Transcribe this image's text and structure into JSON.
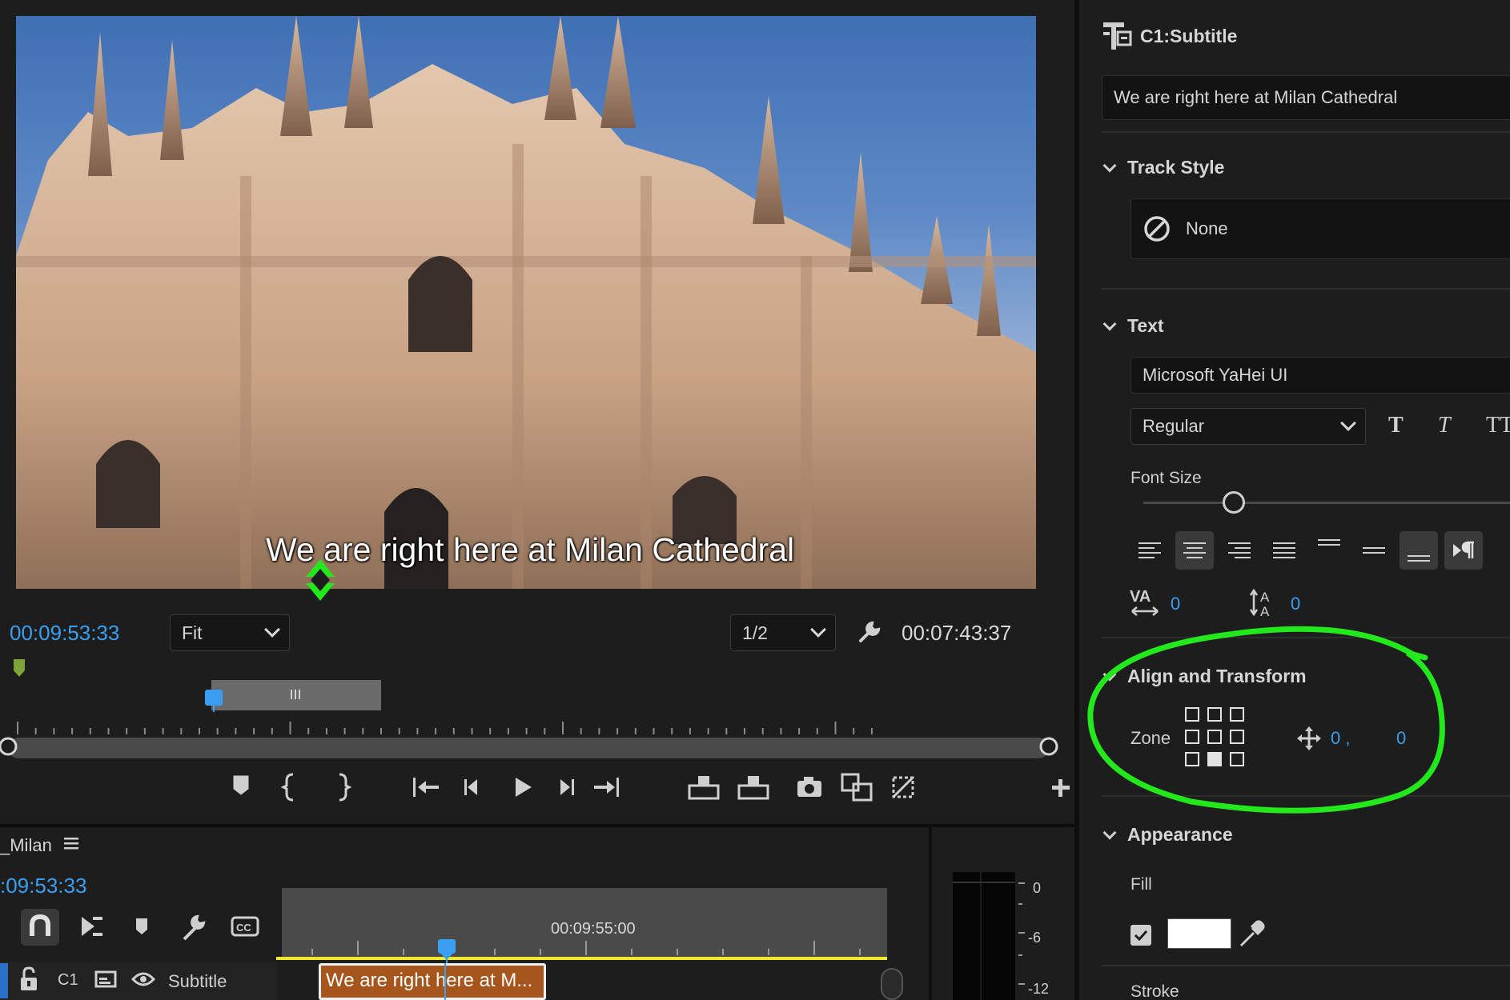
{
  "monitor": {
    "subtitle_overlay": "We are right here at Milan Cathedral",
    "playhead_timecode": "00:09:53:33",
    "zoom_value": "Fit",
    "resolution_value": "1/2",
    "duration_timecode": "00:07:43:37"
  },
  "timeline": {
    "sequence_name": "_Milan",
    "timecode": ":09:53:33",
    "ruler_time": "00:09:55:00",
    "track_label": "C1",
    "track_name": "Subtitle",
    "clip_text": "We are right here at M..."
  },
  "meter": {
    "labels": [
      "0",
      "-6",
      "-12"
    ]
  },
  "panel": {
    "header_title": "C1:Subtitle",
    "caption_text": "We are right here at Milan Cathedral",
    "track_style": {
      "title": "Track Style",
      "value": "None"
    },
    "text": {
      "title": "Text",
      "font": "Microsoft YaHei UI",
      "style": "Regular",
      "font_size_label": "Font Size",
      "font_size_fraction": 0.24,
      "tracking_value": "0",
      "leading_value": "0"
    },
    "align_transform": {
      "title": "Align and Transform",
      "zone_label": "Zone",
      "pos_x": "0 ,",
      "pos_y": "0",
      "active_zone": 7
    },
    "appearance": {
      "title": "Appearance",
      "fill_label": "Fill",
      "fill_color": "#ffffff",
      "stroke_label": "Stroke"
    }
  },
  "colors": {
    "accent_blue": "#3a9ff0",
    "annotation_green": "#22e81c",
    "timeline_yellow": "#f1e72d",
    "clip_orange": "#a6561c"
  }
}
